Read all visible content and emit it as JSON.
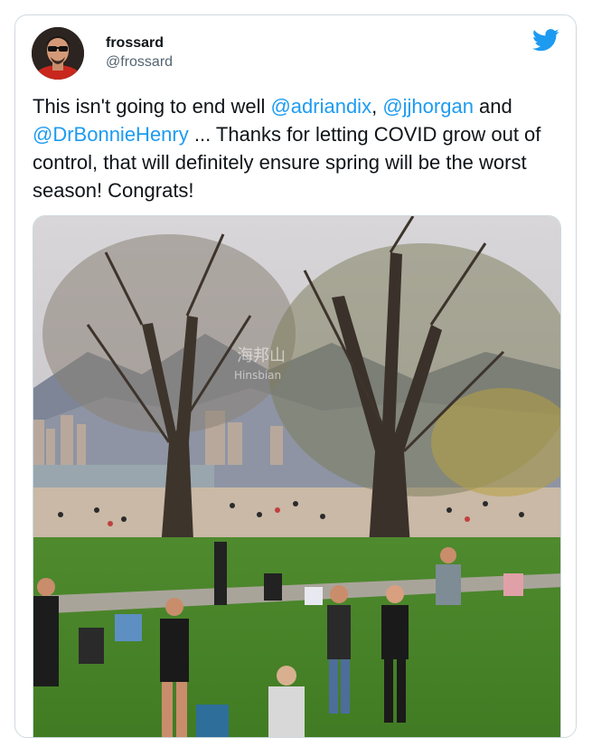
{
  "user": {
    "display_name": "frossard",
    "handle": "@frossard"
  },
  "tweet": {
    "segments": [
      {
        "text": "This isn't going to end well ",
        "type": "text"
      },
      {
        "text": "@adriandix",
        "type": "mention"
      },
      {
        "text": ", ",
        "type": "text"
      },
      {
        "text": "@jjhorgan",
        "type": "mention"
      },
      {
        "text": " and ",
        "type": "text"
      },
      {
        "text": "@DrBonnieHenry",
        "type": "mention"
      },
      {
        "text": " ... Thanks for letting COVID grow out of control, that will definitely ensure spring will be the worst season! Congrats!",
        "type": "text"
      }
    ]
  },
  "media": {
    "watermark_cn": "海邦山",
    "watermark_en": "Hinsbian"
  },
  "colors": {
    "link": "#1d9bf0",
    "border": "#cfd9de",
    "secondary_text": "#536471"
  },
  "icons": {
    "logo": "twitter-bird-icon"
  }
}
